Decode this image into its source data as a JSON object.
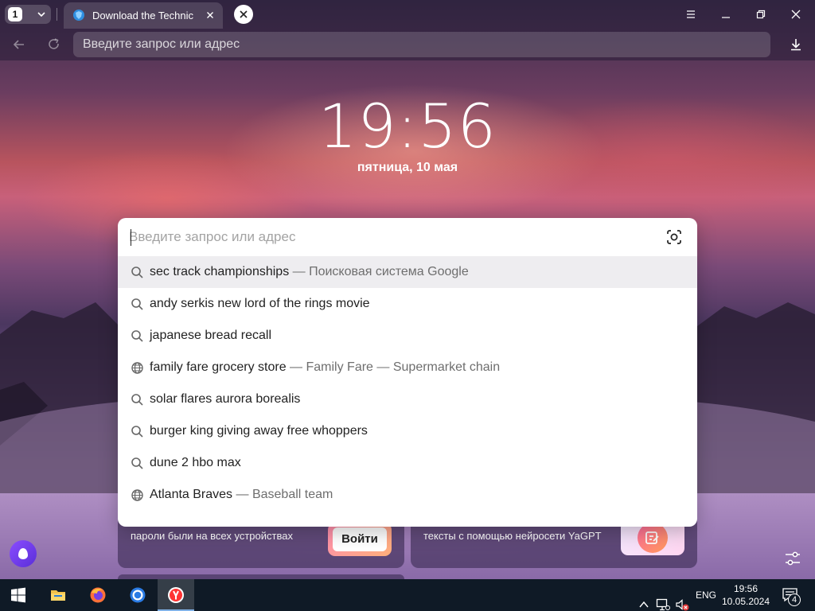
{
  "browser": {
    "tab_count": "1",
    "active_tab_title": "Download the Technic",
    "address_placeholder": "Введите запрос или адрес"
  },
  "newtab": {
    "clock": "19:56",
    "date": "пятница, 10 мая",
    "search_placeholder": "Введите запрос или адрес",
    "suggestions": [
      {
        "query": "sec track championships",
        "hint": " — Поисковая система Google",
        "icon": "search-icon"
      },
      {
        "query": "andy serkis new lord of the rings movie",
        "hint": "",
        "icon": "search-icon"
      },
      {
        "query": "japanese bread recall",
        "hint": "",
        "icon": "search-icon"
      },
      {
        "query": "family fare grocery store",
        "hint": " — Family Fare — Supermarket chain",
        "icon": "globe-icon"
      },
      {
        "query": "solar flares aurora borealis",
        "hint": "",
        "icon": "search-icon"
      },
      {
        "query": "burger king giving away free whoppers",
        "hint": "",
        "icon": "search-icon"
      },
      {
        "query": "dune 2 hbo max",
        "hint": "",
        "icon": "search-icon"
      },
      {
        "query": "Atlanta Braves",
        "hint": " — Baseball team",
        "icon": "globe-icon"
      }
    ],
    "cards": [
      {
        "text": "пароли были на всех устройствах",
        "button": "Войти"
      },
      {
        "text": "тексты с помощью нейросети YaGPT"
      }
    ]
  },
  "taskbar": {
    "language": "ENG",
    "time": "19:56",
    "date": "10.05.2024",
    "notification_count": "4"
  },
  "colors": {
    "accent": "#7fb0e6",
    "suggestion_hover": "#eeedf0",
    "taskbar": "#0f1a26"
  }
}
